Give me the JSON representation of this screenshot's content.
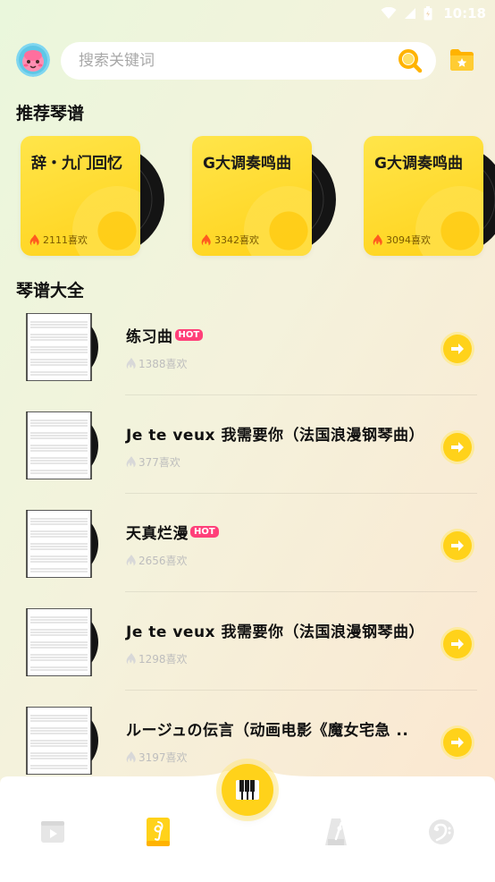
{
  "status_bar": {
    "time": "10:18"
  },
  "header": {
    "search": {
      "placeholder": "搜索关键词"
    }
  },
  "recommended": {
    "section_title": "推荐琴谱",
    "cards": [
      {
        "title": "辞・九门回忆",
        "likes": "2111喜欢"
      },
      {
        "title": "G大调奏鸣曲",
        "likes": "3342喜欢"
      },
      {
        "title": "G大调奏鸣曲",
        "likes": "3094喜欢"
      }
    ]
  },
  "library": {
    "section_title": "琴谱大全",
    "items": [
      {
        "title": "练习曲",
        "hot": true,
        "hot_label": "HOT",
        "likes": "1388喜欢"
      },
      {
        "title": "Je te veux 我需要你（法国浪漫钢琴曲）",
        "hot": false,
        "likes": "377喜欢"
      },
      {
        "title": "天真烂漫",
        "hot": true,
        "hot_label": "HOT",
        "likes": "2656喜欢"
      },
      {
        "title": "Je te veux 我需要你（法国浪漫钢琴曲）",
        "hot": false,
        "likes": "1298喜欢"
      },
      {
        "title": "ルージュの伝言（动画电影《魔女宅急 ..",
        "hot": false,
        "likes": "3197喜欢"
      }
    ]
  },
  "bottom_nav": {
    "tabs": [
      {
        "name": "video-tab",
        "icon": "play-icon",
        "active": false
      },
      {
        "name": "sheet-music-tab",
        "icon": "music-note-book-icon",
        "active": true
      },
      {
        "name": "piano-tab",
        "icon": "piano-keys-icon",
        "active": false
      },
      {
        "name": "metronome-tab",
        "icon": "metronome-icon",
        "active": false
      },
      {
        "name": "tuner-tab",
        "icon": "bass-clef-icon",
        "active": false
      }
    ]
  },
  "colors": {
    "accent_yellow": "#ffd21a",
    "hot_pink": "#ff3f79",
    "flame_orange": "#ff5a1f"
  }
}
